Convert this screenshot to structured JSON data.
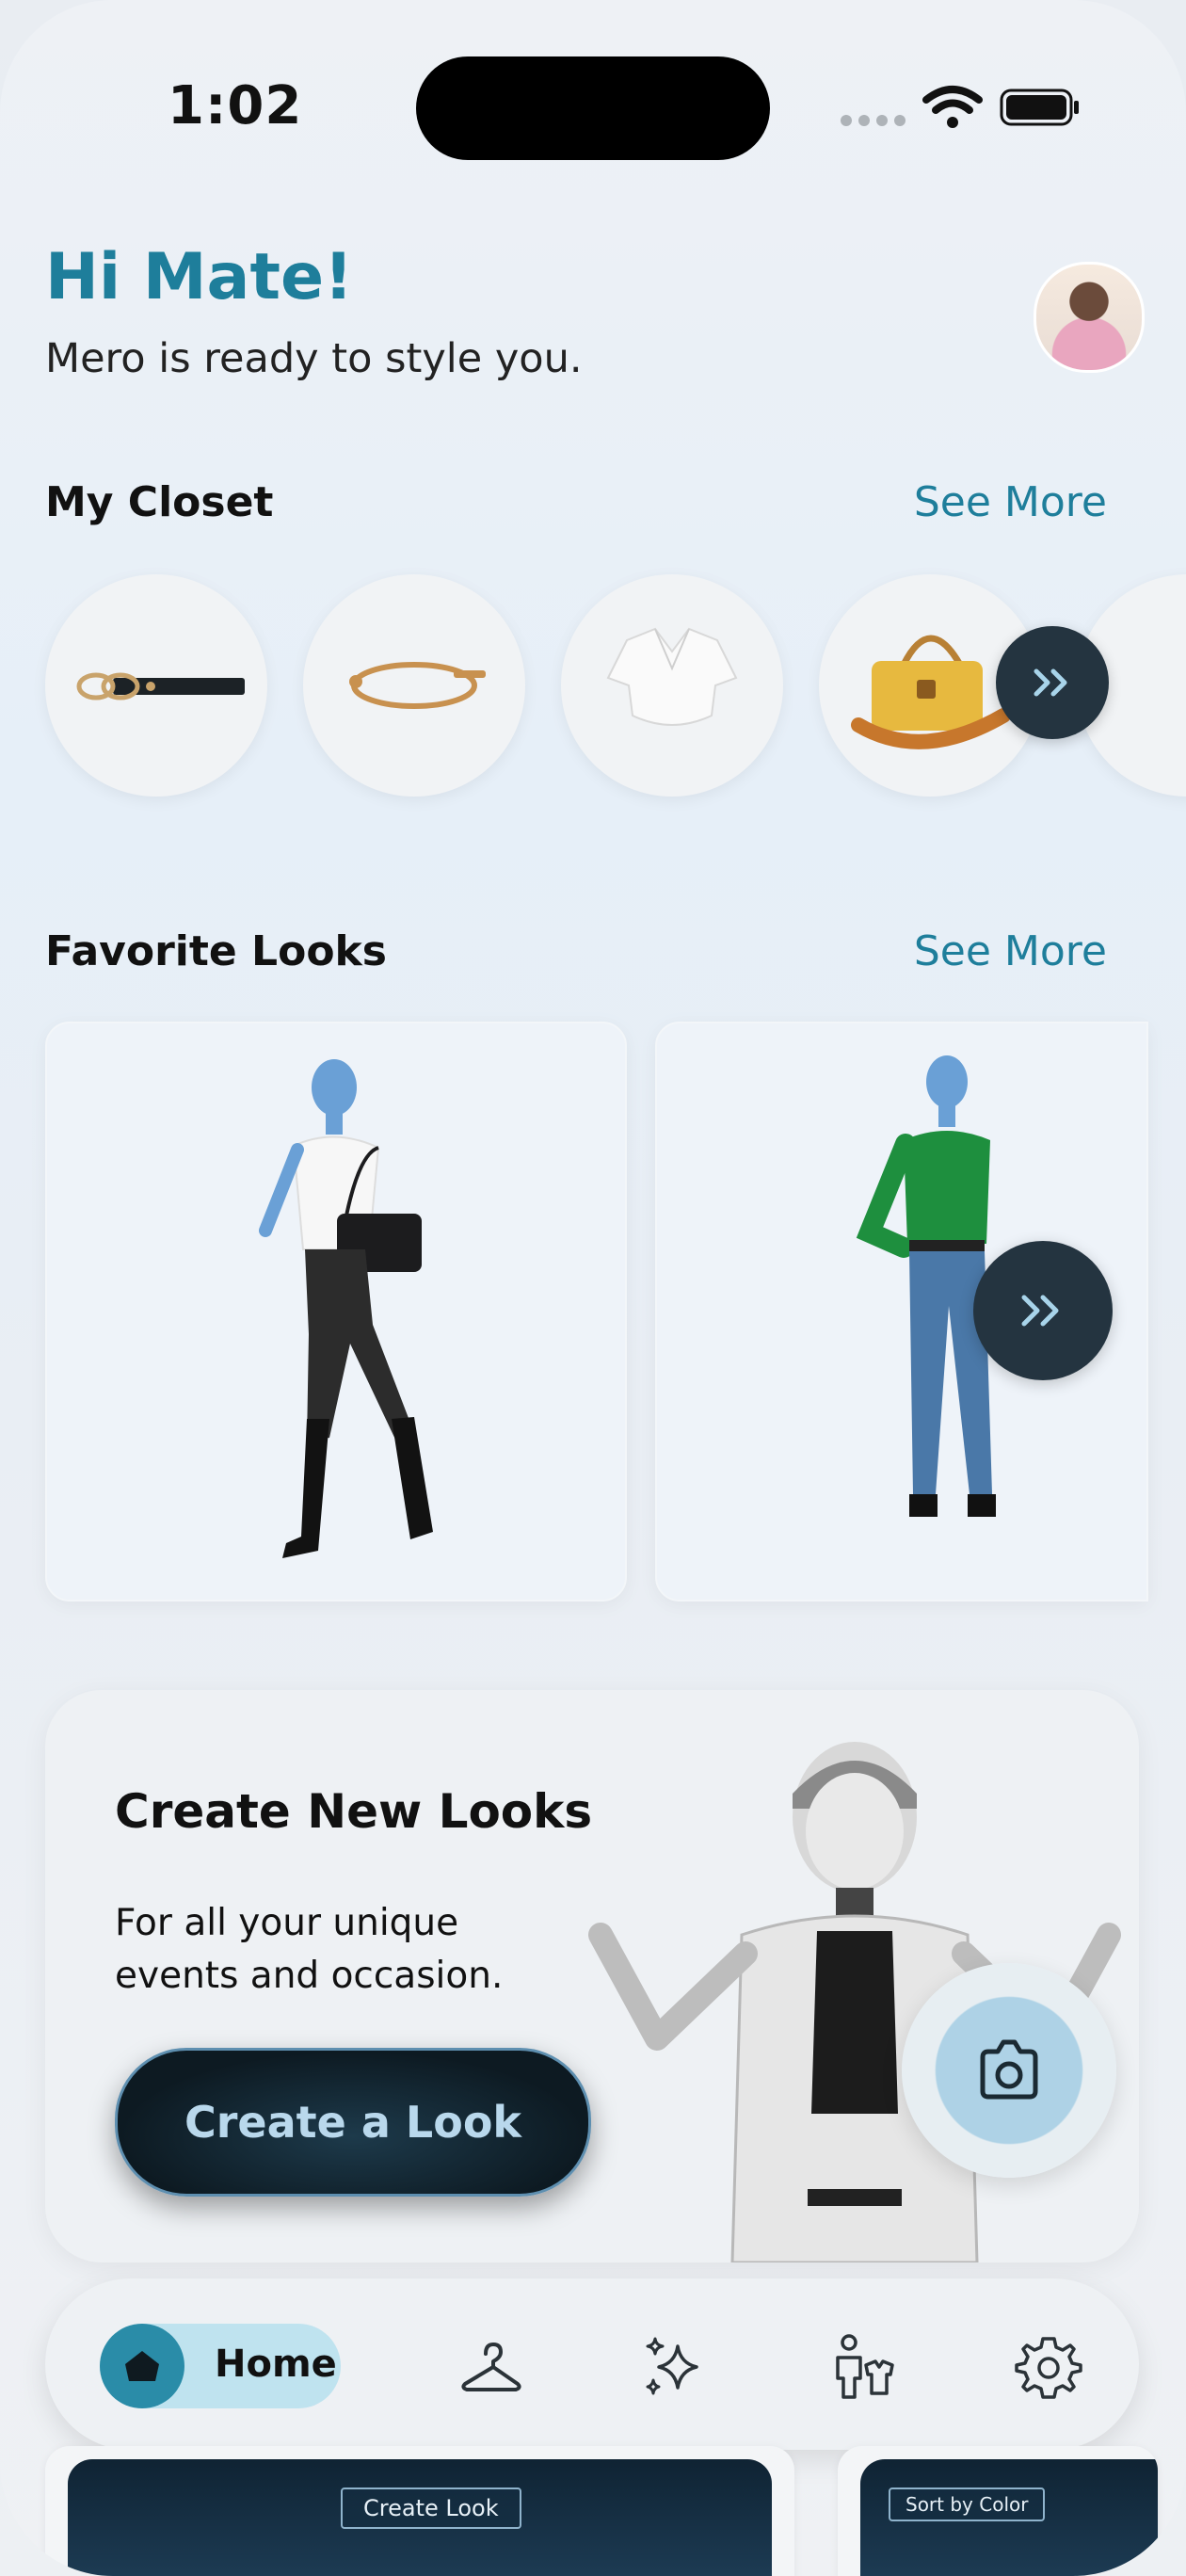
{
  "status_bar": {
    "time": "1:02"
  },
  "header": {
    "greeting": "Hi Mate!",
    "subtitle": "Mero is ready to style you."
  },
  "closet": {
    "title": "My Closet",
    "see_more": "See More",
    "items": [
      {
        "name": "belt"
      },
      {
        "name": "bracelet"
      },
      {
        "name": "white blouse"
      },
      {
        "name": "yellow handbag"
      }
    ]
  },
  "favorites": {
    "title": "Favorite Looks",
    "see_more": "See More"
  },
  "create": {
    "title": "Create New Looks",
    "description": "For all your unique events and occasion.",
    "button": "Create a Look"
  },
  "tabbar": {
    "items": [
      {
        "label": "Home",
        "icon": "home-icon",
        "active": true
      },
      {
        "label": "",
        "icon": "hanger-icon"
      },
      {
        "label": "",
        "icon": "sparkles-icon"
      },
      {
        "label": "",
        "icon": "wardrobe-person-icon"
      },
      {
        "label": "",
        "icon": "gear-icon"
      }
    ]
  },
  "bottom_cards": {
    "card1_tag": "Create Look",
    "card2_tag": "Sort by Color"
  },
  "colors": {
    "accent": "#1e7e9b",
    "dark_button": "#243440",
    "home_pill": "#bfe3ef"
  }
}
